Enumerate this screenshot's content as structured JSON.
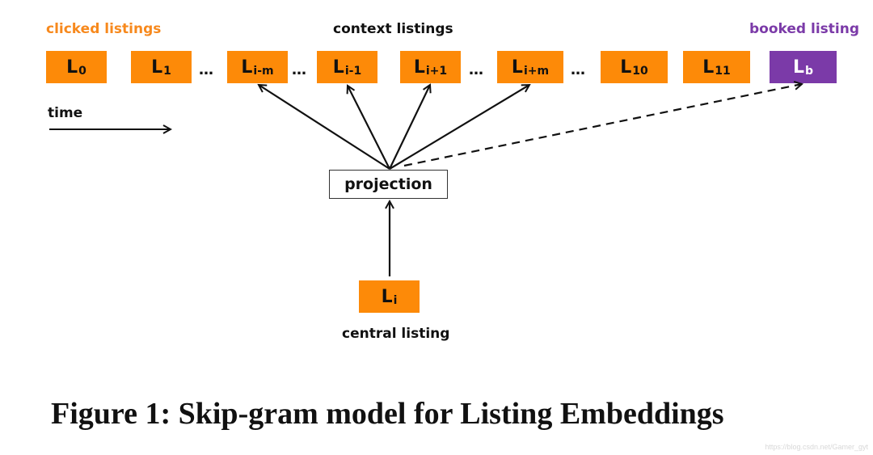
{
  "labels": {
    "clicked": "clicked listings",
    "context": "context listings",
    "booked": "booked listing",
    "time": "time",
    "central": "central listing",
    "projection": "projection"
  },
  "colors": {
    "clicked_orange": "#fd8a08",
    "booked_purple": "#7b3aa8"
  },
  "listings": [
    {
      "base": "L",
      "sub": "0"
    },
    {
      "base": "L",
      "sub": "1"
    },
    {
      "base": "L",
      "sub": "i-m"
    },
    {
      "base": "L",
      "sub": "i-1"
    },
    {
      "base": "L",
      "sub": "i+1"
    },
    {
      "base": "L",
      "sub": "i+m"
    },
    {
      "base": "L",
      "sub": "10"
    },
    {
      "base": "L",
      "sub": "11"
    },
    {
      "base": "L",
      "sub": "b"
    }
  ],
  "central_listing": {
    "base": "L",
    "sub": "i"
  },
  "ellipsis": "…",
  "caption": "Figure 1: Skip-gram model for Listing Embeddings",
  "watermark": "https://blog.csdn.net/Gamer_gyt"
}
